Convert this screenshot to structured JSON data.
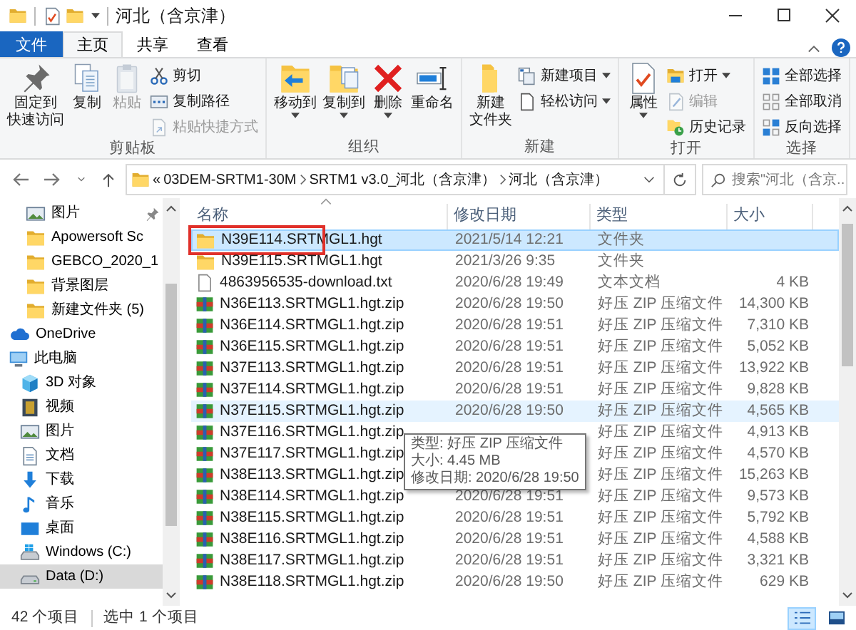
{
  "window": {
    "title": "河北（含京津）"
  },
  "ribbon_tabs": [
    {
      "label": "文件",
      "kind": "file",
      "selected": false
    },
    {
      "label": "主页",
      "kind": "tab",
      "selected": true
    },
    {
      "label": "共享",
      "kind": "tab",
      "selected": false
    },
    {
      "label": "查看",
      "kind": "tab",
      "selected": false
    }
  ],
  "ribbon_groups": [
    {
      "label": "剪贴板",
      "commands": [
        {
          "kind": "large",
          "label": [
            "固定到",
            "快速访问"
          ],
          "disabled": false,
          "has_menu": false
        },
        {
          "kind": "large",
          "label": "复制",
          "disabled": false,
          "has_menu": false
        },
        {
          "kind": "large",
          "label": "粘贴",
          "disabled": true,
          "has_menu": false
        },
        {
          "kind": "small",
          "label": "剪切",
          "disabled": false,
          "has_menu": false
        },
        {
          "kind": "small",
          "label": "复制路径",
          "disabled": false,
          "has_menu": false
        },
        {
          "kind": "small",
          "label": "粘贴快捷方式",
          "disabled": true,
          "has_menu": false
        }
      ]
    },
    {
      "label": "组织",
      "commands": [
        {
          "kind": "large",
          "label": "移动到",
          "disabled": false,
          "has_menu": true
        },
        {
          "kind": "large",
          "label": "复制到",
          "disabled": false,
          "has_menu": true
        },
        {
          "kind": "large",
          "label": "删除",
          "disabled": false,
          "has_menu": true
        },
        {
          "kind": "large",
          "label": "重命名",
          "disabled": false,
          "has_menu": false
        }
      ]
    },
    {
      "label": "新建",
      "commands": [
        {
          "kind": "large",
          "label": [
            "新建",
            "文件夹"
          ],
          "disabled": false,
          "has_menu": false
        },
        {
          "kind": "small",
          "label": "新建项目",
          "disabled": false,
          "has_menu": true
        },
        {
          "kind": "small",
          "label": "轻松访问",
          "disabled": false,
          "has_menu": true
        }
      ]
    },
    {
      "label": "打开",
      "commands": [
        {
          "kind": "large",
          "label": "属性",
          "disabled": false,
          "has_menu": true
        },
        {
          "kind": "small",
          "label": "打开",
          "disabled": false,
          "has_menu": true
        },
        {
          "kind": "small",
          "label": "编辑",
          "disabled": true,
          "has_menu": false
        },
        {
          "kind": "small",
          "label": "历史记录",
          "disabled": false,
          "has_menu": false
        }
      ]
    },
    {
      "label": "选择",
      "commands": [
        {
          "kind": "small",
          "label": "全部选择",
          "disabled": false,
          "has_menu": false
        },
        {
          "kind": "small",
          "label": "全部取消",
          "disabled": false,
          "has_menu": false
        },
        {
          "kind": "small",
          "label": "反向选择",
          "disabled": false,
          "has_menu": false
        }
      ]
    }
  ],
  "address_bar": {
    "overflow": "«",
    "breadcrumbs": [
      "03DEM-SRTM1-30M",
      "SRTM1 v3.0_河北（含京津）",
      "河北（含京津）"
    ]
  },
  "search": {
    "placeholder": "搜索\"河北（含京..."
  },
  "nav_pane": {
    "quick_access": [
      {
        "label": "图片",
        "kind": "pictures",
        "pinned": true,
        "selected": false
      },
      {
        "label": "Apowersoft Sc",
        "kind": "folder",
        "selected": false
      },
      {
        "label": "GEBCO_2020_1",
        "kind": "folder",
        "selected": false
      },
      {
        "label": "背景图层",
        "kind": "folder",
        "selected": false
      },
      {
        "label": "新建文件夹 (5)",
        "kind": "folder",
        "selected": false
      }
    ],
    "items": [
      {
        "label": "OneDrive",
        "kind": "onedrive",
        "selected": false
      },
      {
        "label": "此电脑",
        "kind": "pc",
        "selected": false,
        "children": [
          {
            "label": "3D 对象",
            "kind": "cube",
            "selected": false
          },
          {
            "label": "视频",
            "kind": "video",
            "selected": false
          },
          {
            "label": "图片",
            "kind": "pictures",
            "selected": false
          },
          {
            "label": "文档",
            "kind": "documents",
            "selected": false
          },
          {
            "label": "下载",
            "kind": "downloads",
            "selected": false
          },
          {
            "label": "音乐",
            "kind": "music",
            "selected": false
          },
          {
            "label": "桌面",
            "kind": "desktop",
            "selected": false
          },
          {
            "label": "Windows (C:)",
            "kind": "system_drive",
            "selected": false
          },
          {
            "label": "Data (D:)",
            "kind": "drive",
            "selected": true
          }
        ]
      }
    ]
  },
  "columns": [
    {
      "label": "名称",
      "sorted": true
    },
    {
      "label": "修改日期",
      "sorted": false
    },
    {
      "label": "类型",
      "sorted": false
    },
    {
      "label": "大小",
      "sorted": false
    }
  ],
  "files": [
    {
      "kind": "folder",
      "name": "N39E114.SRTMGL1.hgt",
      "modified": "2021/5/14 12:21",
      "type": "文件夹",
      "selected": true,
      "hovered": false,
      "marked": true
    },
    {
      "kind": "folder",
      "name": "N39E115.SRTMGL1.hgt",
      "modified": "2021/3/26 9:35",
      "type": "文件夹",
      "selected": false,
      "hovered": false,
      "marked": false
    },
    {
      "kind": "text",
      "name": "4863956535-download.txt",
      "modified": "2020/6/28 19:49",
      "type": "文本文档",
      "size": "4 KB",
      "selected": false,
      "hovered": false,
      "marked": false
    },
    {
      "kind": "zip",
      "name": "N36E113.SRTMGL1.hgt.zip",
      "modified": "2020/6/28 19:50",
      "type": "好压 ZIP 压缩文件",
      "size": "14,300 KB",
      "selected": false,
      "hovered": false,
      "marked": false
    },
    {
      "kind": "zip",
      "name": "N36E114.SRTMGL1.hgt.zip",
      "modified": "2020/6/28 19:51",
      "type": "好压 ZIP 压缩文件",
      "size": "7,310 KB",
      "selected": false,
      "hovered": false,
      "marked": false
    },
    {
      "kind": "zip",
      "name": "N36E115.SRTMGL1.hgt.zip",
      "modified": "2020/6/28 19:51",
      "type": "好压 ZIP 压缩文件",
      "size": "5,052 KB",
      "selected": false,
      "hovered": false,
      "marked": false
    },
    {
      "kind": "zip",
      "name": "N37E113.SRTMGL1.hgt.zip",
      "modified": "2020/6/28 19:51",
      "type": "好压 ZIP 压缩文件",
      "size": "13,922 KB",
      "selected": false,
      "hovered": false,
      "marked": false
    },
    {
      "kind": "zip",
      "name": "N37E114.SRTMGL1.hgt.zip",
      "modified": "2020/6/28 19:51",
      "type": "好压 ZIP 压缩文件",
      "size": "9,828 KB",
      "selected": false,
      "hovered": false,
      "marked": false
    },
    {
      "kind": "zip",
      "name": "N37E115.SRTMGL1.hgt.zip",
      "modified": "2020/6/28 19:50",
      "type": "好压 ZIP 压缩文件",
      "size": "4,565 KB",
      "selected": false,
      "hovered": true,
      "marked": false
    },
    {
      "kind": "zip",
      "name": "N37E116.SRTMGL1.hgt.zip",
      "type": "好压 ZIP 压缩文件",
      "size": "4,913 KB",
      "selected": false,
      "hovered": false,
      "marked": false
    },
    {
      "kind": "zip",
      "name": "N37E117.SRTMGL1.hgt.zip",
      "type": "好压 ZIP 压缩文件",
      "size": "4,570 KB",
      "selected": false,
      "hovered": false,
      "marked": false
    },
    {
      "kind": "zip",
      "name": "N38E113.SRTMGL1.hgt.zip",
      "type": "好压 ZIP 压缩文件",
      "size": "15,263 KB",
      "selected": false,
      "hovered": false,
      "marked": false
    },
    {
      "kind": "zip",
      "name": "N38E114.SRTMGL1.hgt.zip",
      "modified": "2020/6/28 19:51",
      "type": "好压 ZIP 压缩文件",
      "size": "9,573 KB",
      "selected": false,
      "hovered": false,
      "marked": false
    },
    {
      "kind": "zip",
      "name": "N38E115.SRTMGL1.hgt.zip",
      "modified": "2020/6/28 19:51",
      "type": "好压 ZIP 压缩文件",
      "size": "5,792 KB",
      "selected": false,
      "hovered": false,
      "marked": false
    },
    {
      "kind": "zip",
      "name": "N38E116.SRTMGL1.hgt.zip",
      "modified": "2020/6/28 19:51",
      "type": "好压 ZIP 压缩文件",
      "size": "4,588 KB",
      "selected": false,
      "hovered": false,
      "marked": false
    },
    {
      "kind": "zip",
      "name": "N38E117.SRTMGL1.hgt.zip",
      "modified": "2020/6/28 19:51",
      "type": "好压 ZIP 压缩文件",
      "size": "3,321 KB",
      "selected": false,
      "hovered": false,
      "marked": false
    },
    {
      "kind": "zip",
      "name": "N38E118.SRTMGL1.hgt.zip",
      "modified": "2020/6/28 19:50",
      "type": "好压 ZIP 压缩文件",
      "size": "629 KB",
      "selected": false,
      "hovered": false,
      "marked": false
    }
  ],
  "tooltip": {
    "lines": [
      "类型: 好压 ZIP 压缩文件",
      "大小: 4.45 MB",
      "修改日期: 2020/6/28 19:50"
    ]
  },
  "status_bar": {
    "item_count": "42 个项目",
    "selection": "选中 1 个项目",
    "view_buttons": [
      {
        "kind": "details",
        "selected": true
      },
      {
        "kind": "large_icons",
        "selected": false
      }
    ]
  }
}
